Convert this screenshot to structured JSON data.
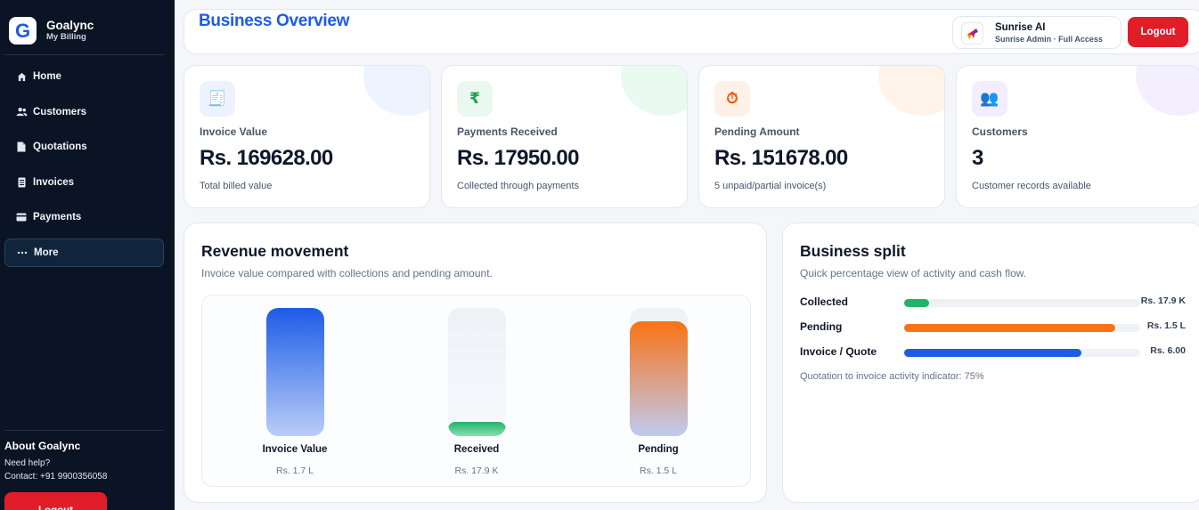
{
  "sidebar": {
    "brand_letter": "G",
    "brand_name": "Goalync",
    "brand_sub": "My Billing",
    "items": [
      {
        "label": "Home",
        "icon": "home-icon"
      },
      {
        "label": "Customers",
        "icon": "users-icon"
      },
      {
        "label": "Quotations",
        "icon": "document-icon"
      },
      {
        "label": "Invoices",
        "icon": "receipt-icon"
      },
      {
        "label": "Payments",
        "icon": "card-icon"
      },
      {
        "label": "More",
        "icon": "dots-icon",
        "active": true
      }
    ],
    "about_title": "About Goalync",
    "help_text": "Need help?",
    "contact_text": "Contact: +91 9900356058",
    "logout_label": "Logout"
  },
  "header": {
    "title": "Business Overview",
    "user_name": "Sunrise AI",
    "user_role": "Sunrise Admin · Full Access",
    "logout_label": "Logout"
  },
  "stats": [
    {
      "label": "Invoice Value",
      "value": "Rs. 169628.00",
      "note": "Total billed value",
      "icon": "invoice-icon",
      "icon_char": "🧾",
      "color": "#6d7bf2",
      "tint": "#eef2ff",
      "blob": "#eef4ff"
    },
    {
      "label": "Payments Received",
      "value": "Rs. 17950.00",
      "note": "Collected through payments",
      "icon": "rupee-icon",
      "icon_char": "₹",
      "color": "#16a34a",
      "tint": "#e9f9ef",
      "blob": "#eafaf0"
    },
    {
      "label": "Pending Amount",
      "value": "Rs. 151678.00",
      "note": "5 unpaid/partial invoice(s)",
      "icon": "stopwatch-icon",
      "icon_char": "⏱",
      "color": "#ea580c",
      "tint": "#fff1e8",
      "blob": "#fff3ea"
    },
    {
      "label": "Customers",
      "value": "3",
      "note": "Customer records available",
      "icon": "users-icon",
      "icon_char": "👥",
      "color": "#7c3aed",
      "tint": "#f3edff",
      "blob": "#f4efff"
    }
  ],
  "revenue": {
    "title": "Revenue movement",
    "subtitle": "Invoice value compared with collections and pending amount.",
    "bars": [
      {
        "label": "Invoice Value",
        "value_text": "Rs. 1.7 L",
        "fill": 1.0,
        "gradient_top": "#1d5ce6",
        "gradient_bottom": "#b9cdf9"
      },
      {
        "label": "Received",
        "value_text": "Rs. 17.9 K",
        "fill": 0.106,
        "gradient_top": "#22b36a",
        "gradient_bottom": "#86e0b0"
      },
      {
        "label": "Pending",
        "value_text": "Rs. 1.5 L",
        "fill": 0.894,
        "gradient_top": "#f97316",
        "gradient_bottom": "#bfcbf0"
      }
    ]
  },
  "split": {
    "title": "Business split",
    "subtitle": "Quick percentage view of activity and cash flow.",
    "rows": [
      {
        "label": "Collected",
        "value_text": "Rs. 17.9 K",
        "fraction": 0.106,
        "color": "#22b36a"
      },
      {
        "label": "Pending",
        "value_text": "Rs. 1.5 L",
        "fraction": 0.894,
        "color": "#f97316"
      },
      {
        "label": "Invoice / Quote",
        "value_text": "Rs. 6.00",
        "fraction": 0.75,
        "color": "#1d5ce6"
      }
    ],
    "footnote": "Quotation to invoice activity indicator: 75%"
  }
}
